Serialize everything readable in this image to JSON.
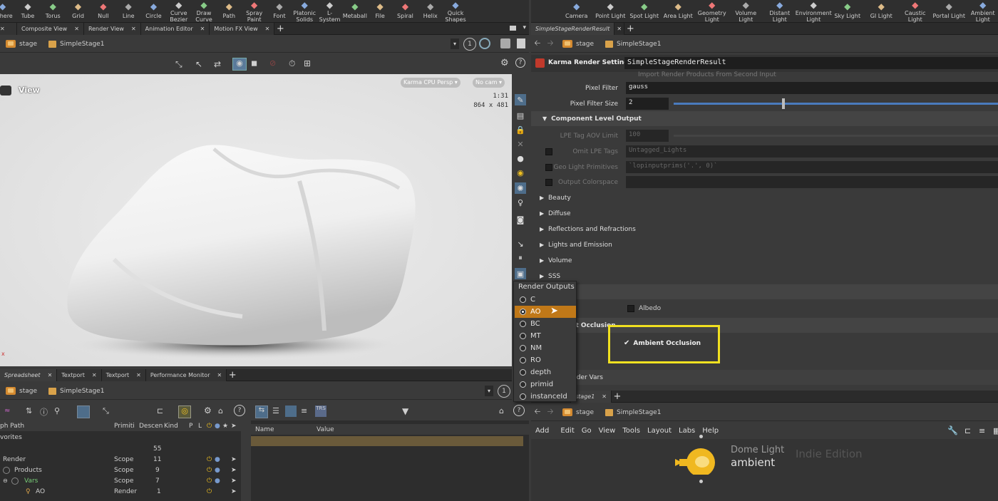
{
  "shelf_left": [
    {
      "label": "Sphere",
      "icon": "sphere-icon"
    },
    {
      "label": "Tube",
      "icon": "tube-icon"
    },
    {
      "label": "Torus",
      "icon": "torus-icon"
    },
    {
      "label": "Grid",
      "icon": "grid-icon"
    },
    {
      "label": "Null",
      "icon": "null-icon"
    },
    {
      "label": "Line",
      "icon": "line-icon"
    },
    {
      "label": "Circle",
      "icon": "circle-icon"
    },
    {
      "label": "Curve Bezier",
      "icon": "curve-bezier-icon"
    },
    {
      "label": "Draw Curve",
      "icon": "draw-curve-icon"
    },
    {
      "label": "Path",
      "icon": "path-icon"
    },
    {
      "label": "Spray Paint",
      "icon": "spray-paint-icon"
    },
    {
      "label": "Font",
      "icon": "font-icon"
    },
    {
      "label": "Platonic Solids",
      "icon": "platonic-icon"
    },
    {
      "label": "L-System",
      "icon": "lsystem-icon"
    },
    {
      "label": "Metaball",
      "icon": "metaball-icon"
    },
    {
      "label": "File",
      "icon": "file-icon"
    },
    {
      "label": "Spiral",
      "icon": "spiral-icon"
    },
    {
      "label": "Helix",
      "icon": "helix-icon"
    },
    {
      "label": "Quick Shapes",
      "icon": "quick-shapes-icon"
    }
  ],
  "shelf_right": [
    {
      "label": "Camera",
      "icon": "camera-icon"
    },
    {
      "label": "Point Light",
      "icon": "point-light-icon"
    },
    {
      "label": "Spot Light",
      "icon": "spot-light-icon"
    },
    {
      "label": "Area Light",
      "icon": "area-light-icon"
    },
    {
      "label": "Geometry Light",
      "icon": "geometry-light-icon"
    },
    {
      "label": "Volume Light",
      "icon": "volume-light-icon"
    },
    {
      "label": "Distant Light",
      "icon": "distant-light-icon"
    },
    {
      "label": "Environment Light",
      "icon": "environment-light-icon"
    },
    {
      "label": "Sky Light",
      "icon": "sky-light-icon"
    },
    {
      "label": "GI Light",
      "icon": "gi-light-icon"
    },
    {
      "label": "Caustic Light",
      "icon": "caustic-light-icon"
    },
    {
      "label": "Portal Light",
      "icon": "portal-light-icon"
    },
    {
      "label": "Ambient Light",
      "icon": "ambient-light-icon"
    }
  ],
  "view_tabs": [
    "Composite View",
    "Render View",
    "Animation Editor",
    "Motion FX View"
  ],
  "param_tab": "SimpleStageRenderResult",
  "path": {
    "root": "stage",
    "node": "SimpleStage1"
  },
  "viewport": {
    "title": "View",
    "renderer": "Karma CPU  Persp",
    "camera": "No cam",
    "ratio": "1:31",
    "resolution": "864 x 481"
  },
  "params": {
    "node_type": "Karma Render Settings",
    "node_name": "SimpleStageRenderResult",
    "import_label": "Import Render Products From Second Input",
    "pixel_filter_label": "Pixel Filter",
    "pixel_filter": "gauss",
    "pixel_filter_size_label": "Pixel Filter Size",
    "pixel_filter_size": "2",
    "section_component": "Component Level Output",
    "lpe_limit_label": "LPE Tag AOV Limit",
    "lpe_limit": "100",
    "omit_lpe_label": "Omit LPE Tags",
    "omit_lpe": "Untagged_Lights",
    "geo_light_label": "Geo Light Primitives",
    "geo_light": "`lopinputprims('.', 0)`",
    "output_colorspace_label": "Output Colorspace",
    "folders": [
      "Beauty",
      "Diffuse",
      "Reflections and Refractions",
      "Lights and Emission",
      "Volume",
      "SSS"
    ],
    "albedo": "Albedo",
    "ao_section": "nt Occlusion",
    "ao_check": "Ambient Occlusion",
    "render_vars": "nder Vars"
  },
  "popup": {
    "title": "Render Outputs",
    "items": [
      "C",
      "AO",
      "BC",
      "MT",
      "NM",
      "RO",
      "depth",
      "primid",
      "instanceId"
    ],
    "selected": "AO"
  },
  "scene_tabs": [
    "Spreadsheet",
    "Textport",
    "Textport",
    "Performance Monitor"
  ],
  "scene_columns": [
    "ph Path",
    "Primiti",
    "Descen",
    "Kind",
    "P",
    "L"
  ],
  "scene_rows": [
    {
      "path": "vorites",
      "prim": "",
      "desc": "",
      "kind": ""
    },
    {
      "path": "",
      "prim": "",
      "desc": "55",
      "kind": ""
    },
    {
      "path": "Render",
      "prim": "Scope",
      "desc": "11",
      "kind": ""
    },
    {
      "path": "Products",
      "prim": "Scope",
      "desc": "9",
      "kind": ""
    },
    {
      "path": "Vars",
      "prim": "Scope",
      "desc": "7",
      "kind": ""
    },
    {
      "path": "AO",
      "prim": "Render",
      "desc": "1",
      "kind": ""
    }
  ],
  "attr_columns": [
    "Name",
    "Value"
  ],
  "net_tab": "stage1",
  "net_menu": [
    "Add",
    "Edit",
    "Go",
    "View",
    "Tools",
    "Layout",
    "Labs",
    "Help"
  ],
  "net_node": {
    "type": "Dome Light",
    "name": "ambient",
    "watermark": "Indie Edition"
  },
  "colors": {
    "accent": "#c07818",
    "highlight": "#f0e020",
    "node_yellow": "#f0b820"
  }
}
